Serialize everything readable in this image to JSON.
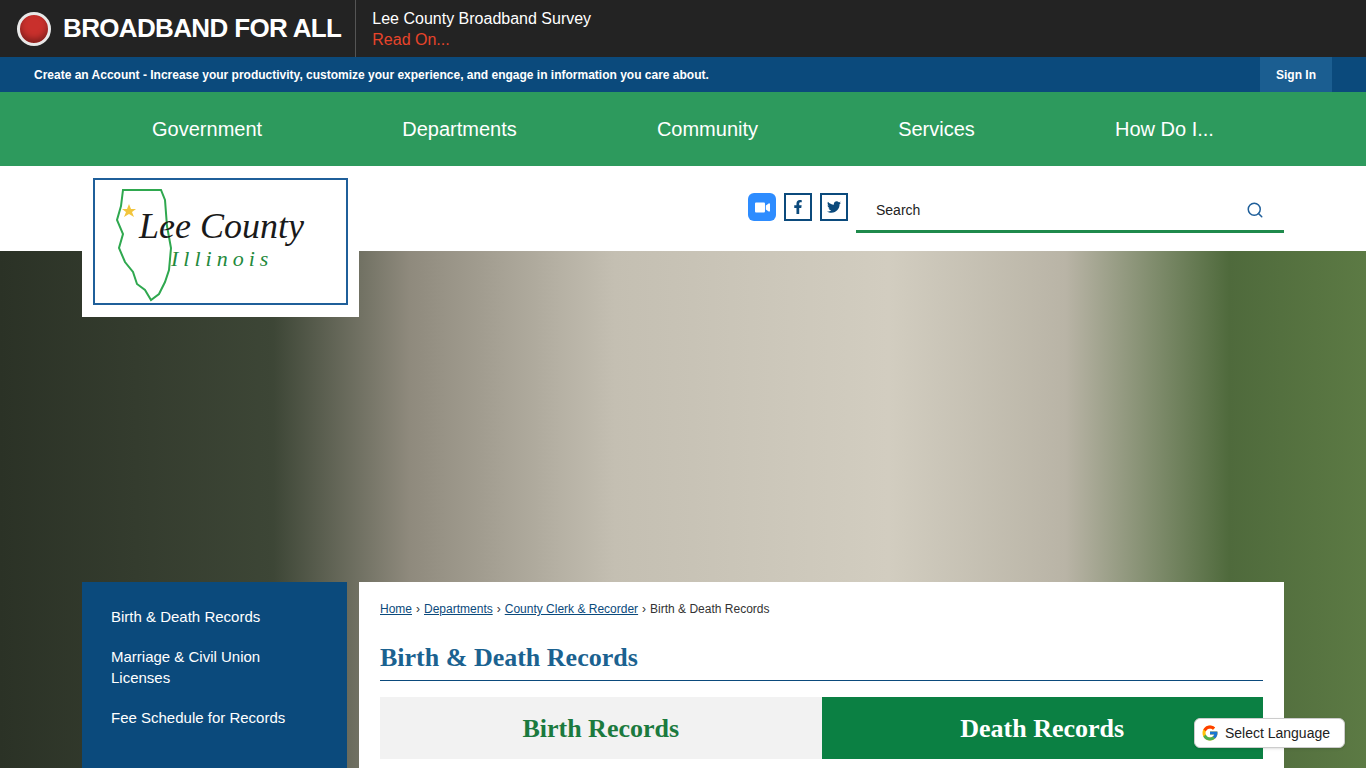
{
  "banner": {
    "title": "BROADBAND FOR ALL",
    "headline": "Lee County Broadband Survey",
    "link": "Read On..."
  },
  "account_bar": {
    "message": "Create an Account - Increase your productivity, customize your experience, and engage in information you care about.",
    "sign_in": "Sign In"
  },
  "nav": [
    "Government",
    "Departments",
    "Community",
    "Services",
    "How Do I..."
  ],
  "logo": {
    "line1": "Lee County",
    "line2": "Illinois"
  },
  "search": {
    "placeholder": "Search"
  },
  "sidebar": {
    "items": [
      "Birth & Death Records",
      "Marriage & Civil Union Licenses",
      "Fee Schedule for Records"
    ]
  },
  "breadcrumb": {
    "separator": "›",
    "items": [
      {
        "label": "Home",
        "link": true
      },
      {
        "label": "Departments",
        "link": true
      },
      {
        "label": "County Clerk & Recorder",
        "link": true
      },
      {
        "label": "Birth & Death Records",
        "link": false
      }
    ]
  },
  "page_title": "Birth & Death Records",
  "tabs": [
    {
      "label": "Birth Records",
      "selected": false
    },
    {
      "label": "Death Records",
      "selected": true
    }
  ],
  "translate": {
    "label": "Select Language"
  }
}
